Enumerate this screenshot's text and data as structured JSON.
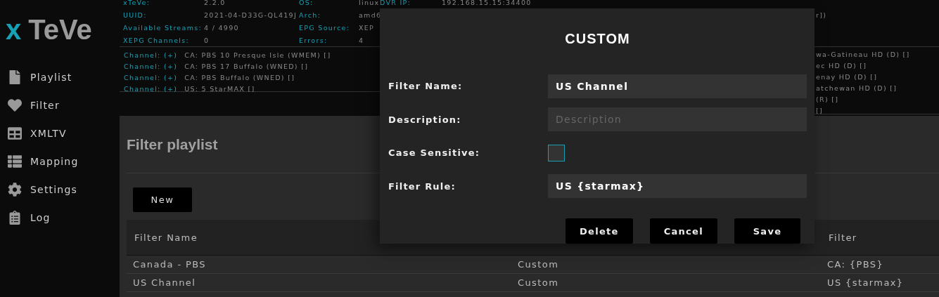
{
  "logo": {
    "accent": "x",
    "text": "TeVe"
  },
  "sidebar": {
    "items": [
      {
        "label": "Playlist"
      },
      {
        "label": "Filter"
      },
      {
        "label": "XMLTV"
      },
      {
        "label": "Mapping"
      },
      {
        "label": "Settings"
      },
      {
        "label": "Log"
      }
    ]
  },
  "status": {
    "rows": [
      {
        "cells": [
          {
            "label": "xTeVe:",
            "value": "2.2.0"
          },
          {
            "label": "OS:",
            "value": "linux"
          },
          {
            "label": "DVR IP:",
            "value": "192.168.15.15:34400"
          }
        ]
      },
      {
        "cells": [
          {
            "label": "UUID:",
            "value": "2021-04-D33G-QL419J"
          },
          {
            "label": "Arch:",
            "value": "amd6"
          }
        ],
        "tail": "r])"
      },
      {
        "cells": [
          {
            "label": "Available Streams:",
            "value": "4 / 4990"
          },
          {
            "label": "EPG Source:",
            "value": "XEP"
          }
        ]
      },
      {
        "cells": [
          {
            "label": "XEPG Channels:",
            "value": "0"
          },
          {
            "label": "Errors:",
            "value": "4"
          }
        ]
      }
    ]
  },
  "channel_log": {
    "lines": [
      {
        "tag": "Channel: (+)",
        "text": "CA: PBS 10 Presque Isle (WMEM) []"
      },
      {
        "tag": "Channel: (+)",
        "text": "CA: PBS 17 Buffalo (WNED) []"
      },
      {
        "tag": "Channel: (+)",
        "text": "CA: PBS Buffalo (WNED) []"
      },
      {
        "tag": "Channel: (+)",
        "text": "US: 5 StarMAX []"
      }
    ],
    "tails": [
      "wa-Gatineau HD (D) []",
      "ec HD (D) []",
      "enay HD (D) []",
      "atchewan HD (D) []",
      "(R) []",
      "[]"
    ]
  },
  "page": {
    "title": "Filter playlist",
    "new_button": "New",
    "table": {
      "columns": [
        "Filter Name",
        null,
        "Filter"
      ],
      "rows": [
        [
          "Canada - PBS",
          "Custom",
          "CA: {PBS}"
        ],
        [
          "US Channel",
          "Custom",
          "US {starmax}"
        ]
      ]
    }
  },
  "dialog": {
    "title": "CUSTOM",
    "fields": [
      {
        "kind": "text",
        "label": "Filter Name:",
        "value": "US Channel"
      },
      {
        "kind": "text",
        "label": "Description:",
        "placeholder": "Description"
      },
      {
        "kind": "checkbox",
        "label": "Case Sensitive:",
        "checked": false
      },
      {
        "kind": "text",
        "label": "Filter Rule:",
        "value": "US {starmax}"
      }
    ],
    "buttons": [
      "Delete",
      "Cancel",
      "Save"
    ]
  }
}
